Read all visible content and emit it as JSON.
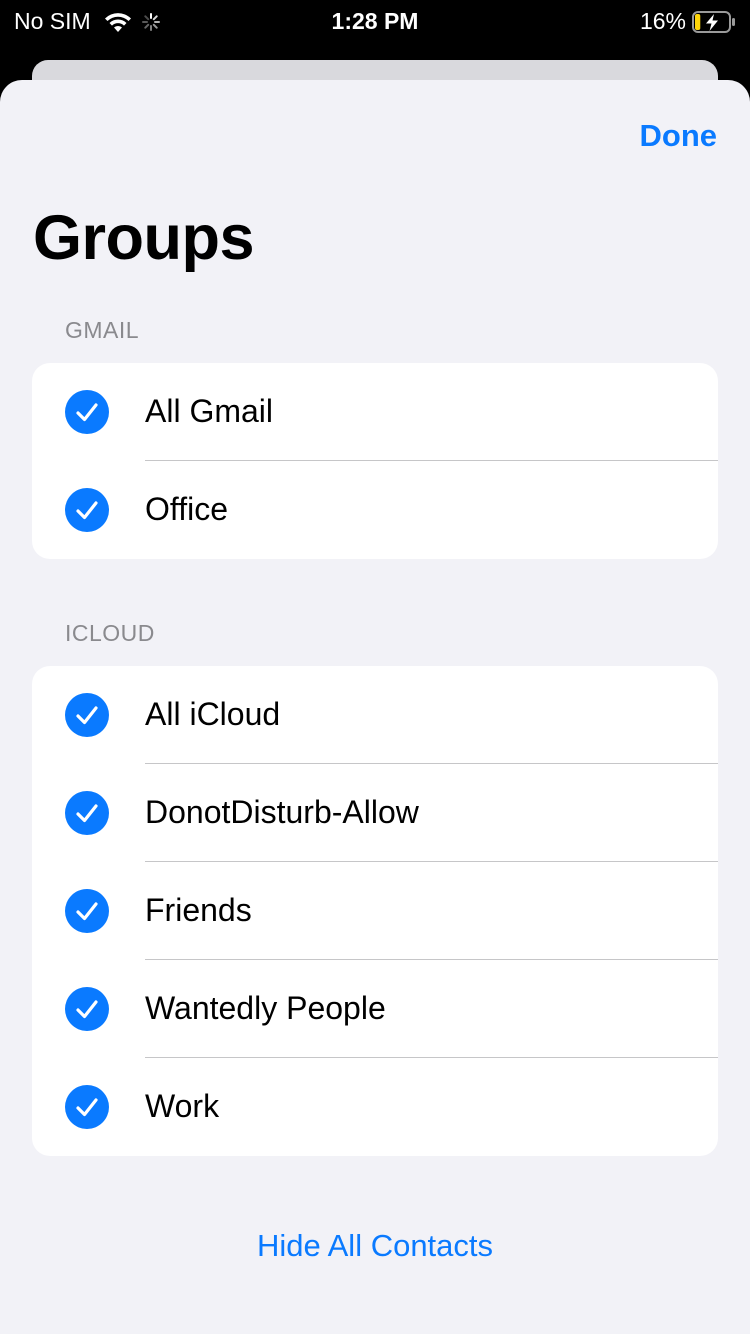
{
  "status_bar": {
    "carrier": "No SIM",
    "time": "1:28 PM",
    "battery_percent": "16%",
    "icons": [
      "wifi-icon",
      "activity-spinner-icon",
      "battery-charging-icon"
    ],
    "battery_level": 0.16
  },
  "colors": {
    "accent": "#0a7aff",
    "sheet_background": "#f2f2f7",
    "card_background": "#ffffff",
    "section_header": "#8a8a8e",
    "battery_fill": "#ffd60a"
  },
  "header": {
    "done_label": "Done",
    "title": "Groups"
  },
  "sections": [
    {
      "header": "GMAIL",
      "items": [
        {
          "label": "All Gmail",
          "checked": true
        },
        {
          "label": "Office",
          "checked": true
        }
      ]
    },
    {
      "header": "ICLOUD",
      "items": [
        {
          "label": "All iCloud",
          "checked": true
        },
        {
          "label": "DonotDisturb-Allow",
          "checked": true
        },
        {
          "label": "Friends",
          "checked": true
        },
        {
          "label": "Wantedly People",
          "checked": true
        },
        {
          "label": "Work",
          "checked": true
        }
      ]
    }
  ],
  "footer": {
    "hide_all_label": "Hide All Contacts"
  }
}
